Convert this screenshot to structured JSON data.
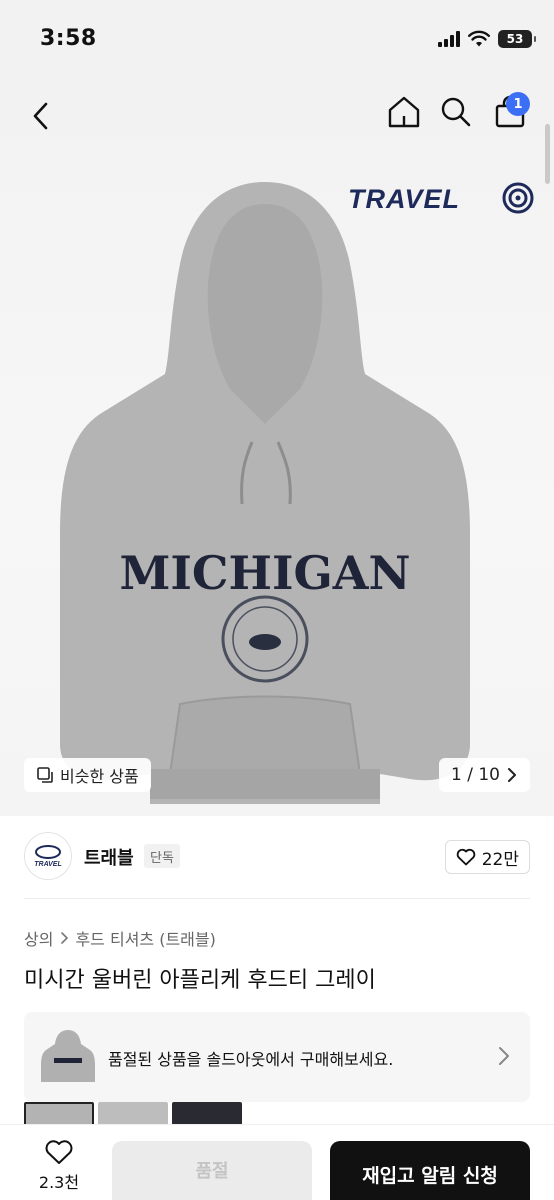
{
  "status_bar": {
    "time": "3:58",
    "battery": "53"
  },
  "nav": {
    "cart_count": "1"
  },
  "product_image": {
    "brand_logo_text": "TRAVEL",
    "print_text": "MICHIGAN",
    "similar_button_label": "비슷한 상품",
    "page_indicator": "1 / 10"
  },
  "brand": {
    "name": "트래블",
    "badge": "단독",
    "avatar_text": "TRAVEL",
    "like_count": "22만"
  },
  "breadcrumb": {
    "category": "상의",
    "subcategory": "후드 티셔츠 (트래블)"
  },
  "product": {
    "title": "미시간 울버린 아플리케 후드티 그레이"
  },
  "soldout_banner": {
    "text": "품절된 상품을 솔드아웃에서 구매해보세요."
  },
  "bottom_bar": {
    "wish_count": "2.3천",
    "soldout_label": "품절",
    "restock_label": "재입고 알림 신청"
  },
  "colors": {
    "accent": "#3b6ff5",
    "primary_button": "#111111",
    "disabled_button": "#ebebeb",
    "logo_navy": "#1e2a5a"
  },
  "icons": [
    "back-icon",
    "home-icon",
    "search-icon",
    "bag-icon",
    "copy-icon",
    "chevron-right-icon",
    "heart-icon"
  ]
}
